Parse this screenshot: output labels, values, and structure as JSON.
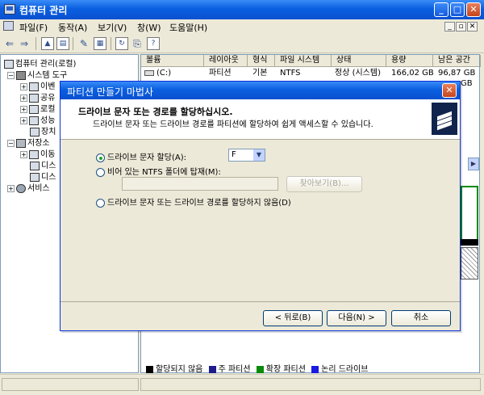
{
  "window": {
    "title": "컴퓨터 관리"
  },
  "menu": [
    "파일(F)",
    "동작(A)",
    "보기(V)",
    "창(W)",
    "도움말(H)"
  ],
  "tree": {
    "root": "컴퓨터 관리(로컬)",
    "system_tools": "시스템 도구",
    "children_a": [
      "이벤",
      "공유",
      "로컬",
      "성능",
      "장치"
    ],
    "storage": "저장소",
    "children_b": [
      "이동",
      "디스",
      "디스"
    ],
    "services": "서비스"
  },
  "list": {
    "columns": [
      "볼륨",
      "레이아웃",
      "형식",
      "파일 시스템",
      "상태",
      "용량",
      "남은 공간"
    ],
    "rows": [
      [
        "(C:)",
        "파티션",
        "기본",
        "NTFS",
        "정상 (시스템)",
        "166,02 GB",
        "96,87 GB"
      ],
      [
        "",
        "",
        "",
        "",
        "",
        "",
        "GB"
      ]
    ]
  },
  "legend": [
    {
      "label": "할당되지 않음",
      "color": "#000000"
    },
    {
      "label": "주 파티션",
      "color": "#1c1c8c"
    },
    {
      "label": "확장 파티션",
      "color": "#0a8a0a"
    },
    {
      "label": "논리 드라이브",
      "color": "#1a1ae0"
    }
  ],
  "dialog": {
    "title": "파티션 만들기 마법사",
    "header_title": "드라이브 문자 또는 경로를 할당하십시오.",
    "header_subtitle": "드라이브 문자 또는 드라이브 경로를 파티션에 할당하여 쉽게 액세스할 수 있습니다.",
    "option1": "드라이브 문자 할당(A):",
    "drive_letter": "F",
    "option2": "비어 있는 NTFS 폴더에 탑재(M):",
    "browse": "찾아보기(B)...",
    "option3": "드라이브 문자 또는 드라이브 경로를 할당하지 않음(D)",
    "back": "< 뒤로(B)",
    "next": "다음(N) >",
    "cancel": "취소"
  }
}
